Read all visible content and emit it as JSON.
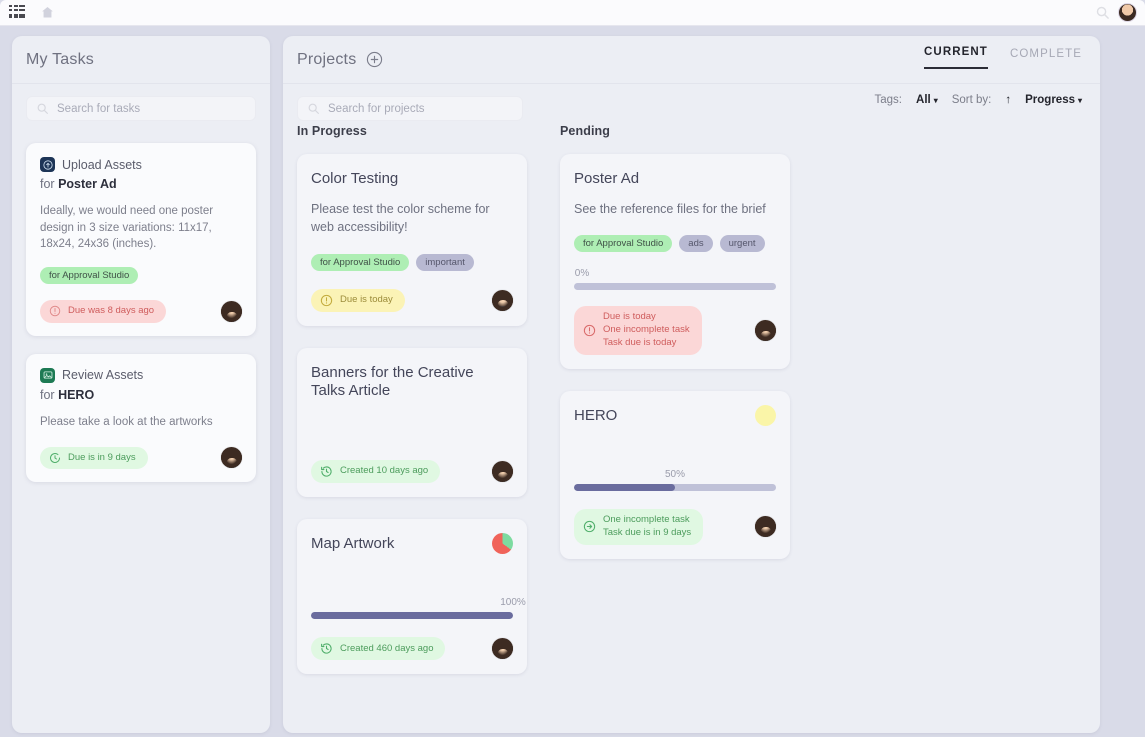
{
  "topbar": {
    "logo_icon": "qr-logo-icon",
    "home_icon": "home-icon",
    "search_icon": "search-icon",
    "avatar": "user-avatar"
  },
  "tasks_panel": {
    "title": "My Tasks",
    "search": {
      "placeholder": "Search for tasks",
      "value": "",
      "icon": "search-icon"
    },
    "cards": [
      {
        "icon": "upload-icon",
        "icon_color": "navy",
        "name": "Upload Assets",
        "for_prefix": "for ",
        "for_target": "Poster Ad",
        "description": "Ideally, we would need one poster design in 3 size variations: 11x17, 18x24, 24x36 (inches).",
        "tags": [
          {
            "label": "for Approval Studio",
            "color": "green"
          }
        ],
        "status": {
          "text": "Due was 8 days ago",
          "color": "red",
          "icon": "alert-circle-icon"
        },
        "avatar": "assignee-avatar"
      },
      {
        "icon": "image-icon",
        "icon_color": "green",
        "name": "Review Assets",
        "for_prefix": "for ",
        "for_target": "HERO",
        "description": "Please take a look at the artworks",
        "tags": [],
        "status": {
          "text": "Due is in 9 days",
          "color": "green",
          "icon": "clock-icon"
        },
        "avatar": "assignee-avatar"
      }
    ]
  },
  "projects_panel": {
    "title": "Projects",
    "add_icon": "plus-circle-icon",
    "search": {
      "placeholder": "Search for projects",
      "value": "",
      "icon": "search-icon"
    },
    "tabs": [
      {
        "label": "CURRENT",
        "active": true
      },
      {
        "label": "COMPLETE",
        "active": false
      }
    ],
    "filters": {
      "tags_label": "Tags:",
      "tags_value": "All",
      "sort_label": "Sort by:",
      "sort_direction_icon": "arrow-up-icon",
      "sort_direction": "↑",
      "sort_value": "Progress"
    },
    "columns": [
      {
        "title": "In Progress",
        "cards": [
          {
            "title": "Color Testing",
            "description": "Please test the color scheme for web accessibility!",
            "tags": [
              {
                "label": "for Approval Studio",
                "color": "green"
              },
              {
                "label": "important",
                "color": "violet"
              }
            ],
            "progress": null,
            "progress_label": "",
            "pie": null,
            "status": {
              "lines": [
                "Due is today"
              ],
              "color": "yellow",
              "icon": "alert-circle-icon"
            },
            "avatar": "assignee-avatar"
          },
          {
            "title": "Banners for the Creative Talks Article",
            "description": "",
            "tags": [],
            "progress": null,
            "progress_label": "",
            "pie": null,
            "status": {
              "lines": [
                "Created 10 days ago"
              ],
              "color": "green",
              "icon": "history-icon"
            },
            "avatar": "assignee-avatar"
          },
          {
            "title": "Map Artwork",
            "description": "",
            "tags": [],
            "progress": 100,
            "progress_label": "100%",
            "pie": {
              "icon": "pie-status-icon",
              "base": "#f0635a",
              "slice": "#7ddba0",
              "percent": 35
            },
            "status": {
              "lines": [
                "Created 460 days ago"
              ],
              "color": "green",
              "icon": "history-icon"
            },
            "avatar": "assignee-avatar"
          }
        ]
      },
      {
        "title": "Pending",
        "cards": [
          {
            "title": "Poster Ad",
            "description": "See the reference files for the brief",
            "tags": [
              {
                "label": "for Approval Studio",
                "color": "green"
              },
              {
                "label": "ads",
                "color": "violet"
              },
              {
                "label": "urgent",
                "color": "violet"
              }
            ],
            "progress": 0,
            "progress_label": "0%",
            "pie": null,
            "status": {
              "lines": [
                "Due is today",
                "One incomplete task",
                "Task due is today"
              ],
              "color": "red",
              "icon": "alert-circle-icon"
            },
            "avatar": "assignee-avatar"
          },
          {
            "title": "HERO",
            "description": "",
            "tags": [],
            "progress": 50,
            "progress_label": "50%",
            "pie": {
              "icon": "pie-status-icon",
              "base": "#faf5a8",
              "slice": "#faf5a8",
              "percent": 100
            },
            "status": {
              "lines": [
                "One incomplete task",
                "Task due is in 9 days"
              ],
              "color": "green",
              "icon": "arrow-right-circle-icon"
            },
            "avatar": "assignee-avatar"
          }
        ]
      }
    ]
  },
  "colors": {
    "page_bg": "#d9dbe8",
    "panel_bg": "#eceef4",
    "card_bg": "#f4f5f9",
    "progress_fill": "#6a6c9e",
    "progress_track": "#bfc1d8",
    "tag_green": "#aeeeb4",
    "tag_violet": "#b8b9d2",
    "status_red": "#fbd7d7",
    "status_yellow": "#fbf3b6",
    "status_green": "#e0f8e2"
  }
}
